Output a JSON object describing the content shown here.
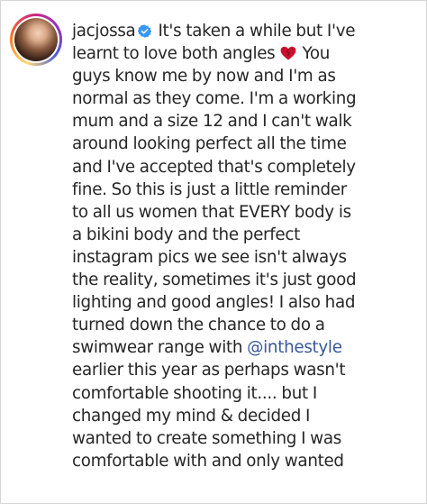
{
  "post": {
    "username": "jacjossa",
    "verified_icon": "verified-badge-icon",
    "heart_icon": "red-heart-emoji-icon",
    "caption_lines": [
      "It's taken a while but I've",
      "learnt to love both angles",
      "You",
      "guys know me by now and I'm as",
      "normal as they come. I'm a working",
      "mum and a size 12 and I can't walk",
      "around looking perfect all the time",
      "and I've accepted that's completely",
      "fine. So this is just a little reminder",
      "to all us women that EVERY body is",
      "a bikini body and the perfect",
      "instagram pics we see isn't always",
      "the reality, sometimes it's just good",
      "lighting and good angles! I also had",
      "turned down the chance to do a",
      "@inthestyle",
      "earlier this year as perhaps wasn't",
      "comfortable shooting it.... but I",
      "changed my mind & decided I",
      "wanted to create something I was",
      "comfortable with and only wanted"
    ],
    "line15_prefix": "swimwear range with",
    "mention": "@inthestyle"
  },
  "colors": {
    "text": "#262626",
    "mention": "#385898",
    "verified": "#3897f0",
    "heart": "#c8102e"
  }
}
